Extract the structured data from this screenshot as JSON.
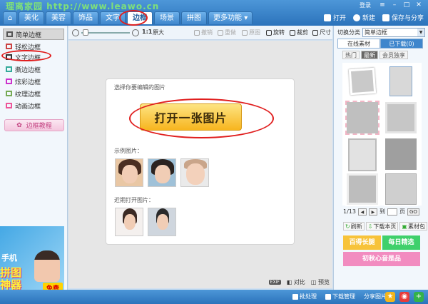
{
  "colors": {
    "accent": "#3f86cc",
    "highlight_red": "#e01e1e",
    "open_button": "#f7b51f",
    "promo_orange": "#f7c33a",
    "promo_green": "#3fd06b",
    "promo_pink": "#f28cc0"
  },
  "header": {
    "watermark": "理离家园 http://www.leawo.cn",
    "login": "登录",
    "tabs": [
      {
        "label": "",
        "icon": "home-icon"
      },
      {
        "label": "美化"
      },
      {
        "label": "美容"
      },
      {
        "label": "饰品"
      },
      {
        "label": "文字"
      },
      {
        "label": "边框",
        "active": true
      },
      {
        "label": "场景"
      },
      {
        "label": "拼图"
      },
      {
        "label": "更多功能"
      }
    ],
    "more_arrow": "▾",
    "actions": {
      "open": "打开",
      "new": "新建",
      "save": "保存与分享"
    }
  },
  "sidebar": {
    "items": [
      {
        "label": "简单边框",
        "icon": "simple-frame-icon",
        "selected": true
      },
      {
        "label": "轻松边框",
        "icon": "easy-frame-icon"
      },
      {
        "label": "文字边框",
        "icon": "text-frame-icon"
      },
      {
        "label": "撕边边框",
        "icon": "torn-frame-icon"
      },
      {
        "label": "炫彩边框",
        "icon": "colorful-frame-icon"
      },
      {
        "label": "纹理边框",
        "icon": "texture-frame-icon"
      },
      {
        "label": "动画边框",
        "icon": "animated-frame-icon"
      }
    ],
    "tutorial": "边框教程",
    "ad": {
      "top": "手机",
      "big1": "拼图",
      "big2": "神器",
      "btn": "免费"
    }
  },
  "toolbar": {
    "zoom_level": 0.05,
    "ratio": "1:1",
    "original": "原大",
    "undo": "撤销",
    "redo": "重做",
    "reset": "原图",
    "rotate": "旋转",
    "crop": "裁剪",
    "size": "尺寸"
  },
  "canvas": {
    "heading": "选择你要编辑的图片",
    "open_button": "打开一张图片",
    "samples_label": "示例图片：",
    "recent_label": "近期打开图片：",
    "footer": {
      "exif": "EXIF",
      "compare": "对比",
      "preview": "预览"
    }
  },
  "rightpanel": {
    "category_label": "切换分类",
    "category_value": "简单边框",
    "tab_online": "在线素材",
    "tab_downloaded": "已下载(0)",
    "subtabs": [
      "热门",
      "最新",
      "会员独享"
    ],
    "active_subtab": 1,
    "pager": {
      "current": "1/13",
      "goto": "到",
      "unit": "页",
      "go": "GO"
    },
    "actions": {
      "refresh": "刷新",
      "download_page": "下载本页",
      "library": "素材包"
    },
    "promos": {
      "a": "百得长腿",
      "b": "每日精选",
      "c": "初秋心音是品"
    }
  },
  "statusbar": {
    "batch": "批处理",
    "download_mgr": "下载管理",
    "share": "分享图片"
  }
}
